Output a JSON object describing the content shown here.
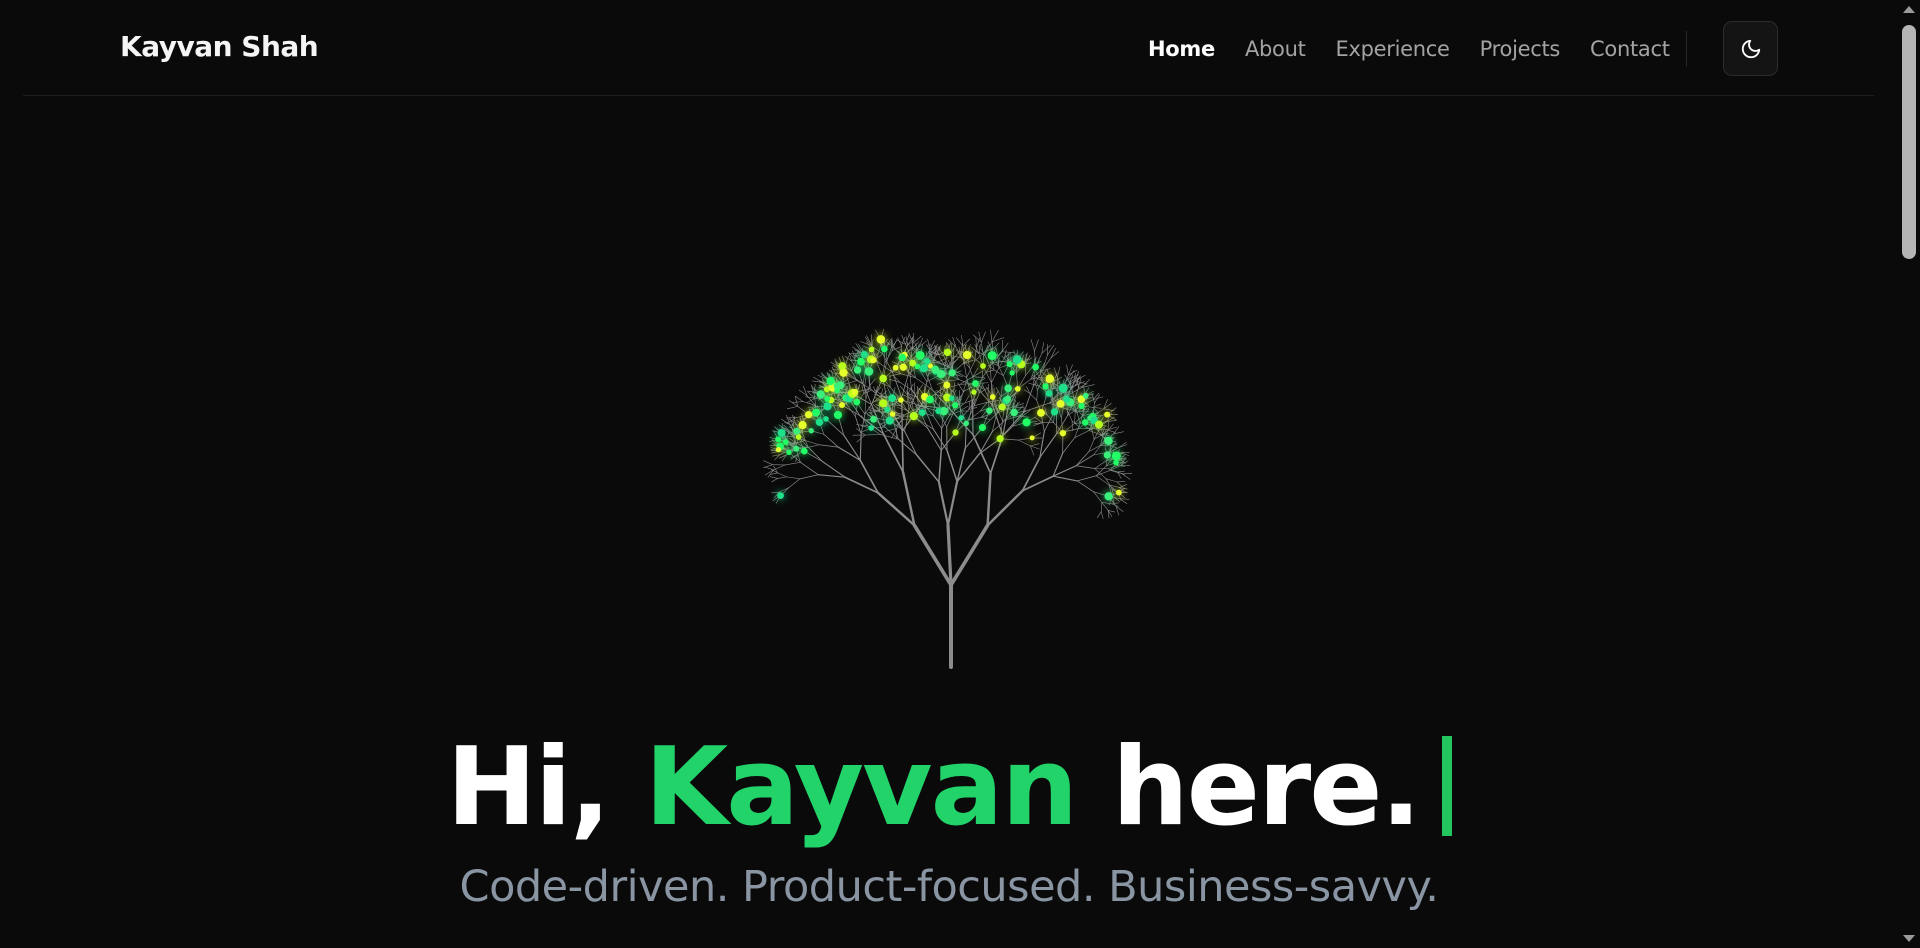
{
  "brand": {
    "name": "Kayvan Shah"
  },
  "nav": {
    "items": [
      {
        "label": "Home",
        "active": true
      },
      {
        "label": "About",
        "active": false
      },
      {
        "label": "Experience",
        "active": false
      },
      {
        "label": "Projects",
        "active": false
      },
      {
        "label": "Contact",
        "active": false
      }
    ]
  },
  "theme_toggle": {
    "icon": "moon-icon"
  },
  "hero": {
    "greeting_prefix": "Hi, ",
    "name": "Kayvan",
    "greeting_suffix": " here.",
    "tagline": "Code-driven. Product-focused. Business-savvy."
  },
  "colors": {
    "background": "#0a0a0a",
    "accent": "#22d36a",
    "text": "#ffffff",
    "muted": "#a3a3a3",
    "tagline": "#8a95a3",
    "branch": "#8c8c8c"
  },
  "illustration": {
    "icon": "glowing-tree-icon"
  }
}
